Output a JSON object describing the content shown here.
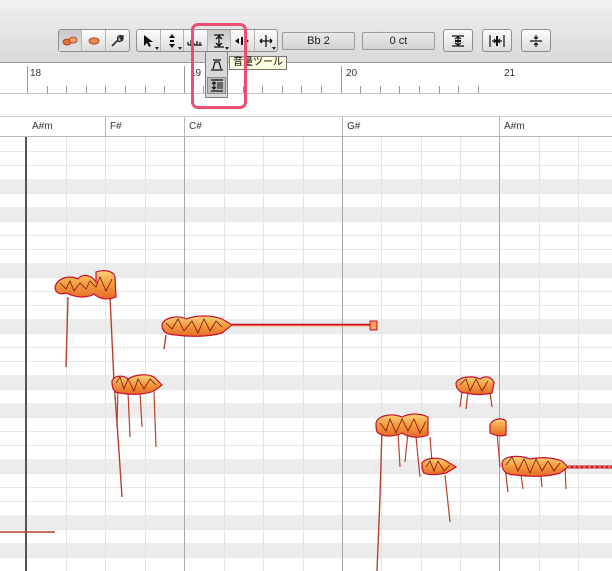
{
  "toolbar": {
    "tools": [
      {
        "name": "blob-tool",
        "icon": "note-blob-icon"
      },
      {
        "name": "single-blob-tool",
        "icon": "blob-icon"
      },
      {
        "name": "edit-tool",
        "icon": "wrench-icon"
      }
    ],
    "edit_tools": [
      "main-tool",
      "pitch-tool",
      "formant-tool",
      "amplitude-tool",
      "time-tool",
      "move-tool"
    ],
    "key_value": "Bb 2",
    "cent_value": "0 ct",
    "right_tools": [
      "pitch-quantize-icon",
      "time-quantize-icon",
      "center-icon"
    ]
  },
  "popup": {
    "items": [
      "amplitude-fade-tool",
      "amplitude-edit-tool"
    ]
  },
  "tooltip": {
    "text": "音量ツール"
  },
  "ruler": {
    "bars": [
      "18",
      "19",
      "20",
      "21"
    ]
  },
  "chords": [
    "A#m",
    "F#",
    "C#",
    "G#",
    "A#m"
  ],
  "colors": {
    "highlight": "#ea4f72",
    "blob_fill": "#f0a04a",
    "blob_edge": "#c8102e",
    "pitch_line": "#b7412a"
  }
}
